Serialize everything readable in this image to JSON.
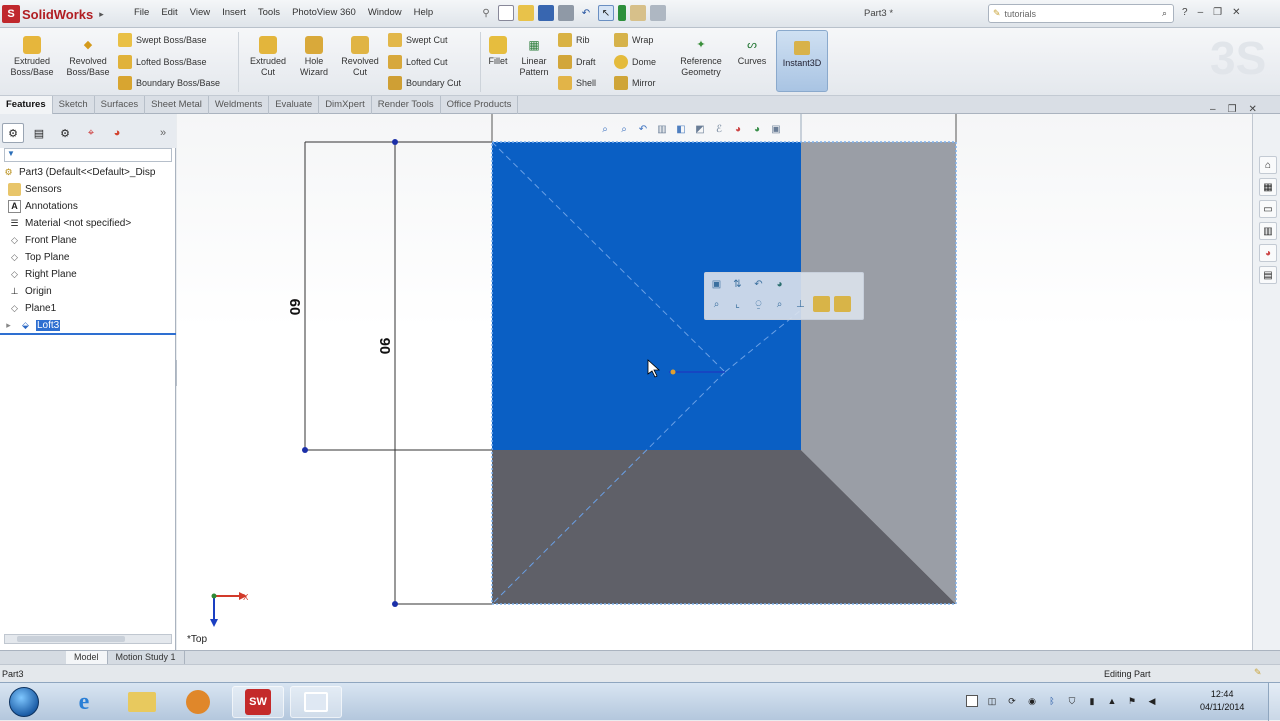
{
  "app": {
    "name": "SolidWorks",
    "document_title": "Part3 *",
    "menus": [
      "File",
      "Edit",
      "View",
      "Insert",
      "Tools",
      "PhotoView 360",
      "Window",
      "Help"
    ],
    "search_placeholder": "tutorials"
  },
  "commands": {
    "extruded_boss": "Extruded Boss/Base",
    "revolved_boss": "Revolved Boss/Base",
    "swept_boss": "Swept Boss/Base",
    "lofted_boss": "Lofted Boss/Base",
    "boundary_boss": "Boundary Boss/Base",
    "extruded_cut": "Extruded Cut",
    "hole_wizard": "Hole Wizard",
    "revolved_cut": "Revolved Cut",
    "swept_cut": "Swept Cut",
    "lofted_cut": "Lofted Cut",
    "boundary_cut": "Boundary Cut",
    "fillet": "Fillet",
    "linear_pattern": "Linear Pattern",
    "rib": "Rib",
    "draft": "Draft",
    "shell": "Shell",
    "wrap": "Wrap",
    "dome": "Dome",
    "mirror": "Mirror",
    "reference_geometry": "Reference Geometry",
    "curves": "Curves",
    "instant3d": "Instant3D"
  },
  "tabs": [
    "Features",
    "Sketch",
    "Surfaces",
    "Sheet Metal",
    "Weldments",
    "Evaluate",
    "DimXpert",
    "Render Tools",
    "Office Products"
  ],
  "feature_tree": {
    "filter_placeholder": "",
    "items": [
      {
        "label": "Part3  (Default<<Default>_Disp",
        "icon": "part-icon"
      },
      {
        "label": "Sensors",
        "icon": "sensors-icon"
      },
      {
        "label": "Annotations",
        "icon": "annotations-icon"
      },
      {
        "label": "Material <not specified>",
        "icon": "material-icon"
      },
      {
        "label": "Front Plane",
        "icon": "plane-icon"
      },
      {
        "label": "Top Plane",
        "icon": "plane-icon"
      },
      {
        "label": "Right Plane",
        "icon": "plane-icon"
      },
      {
        "label": "Origin",
        "icon": "origin-icon"
      },
      {
        "label": "Plane1",
        "icon": "plane-icon"
      },
      {
        "label": "Loft3",
        "icon": "loft-icon",
        "selected": true
      }
    ]
  },
  "graphics": {
    "view_name": "*Top",
    "dimension_left": "60",
    "dimension_right": "90",
    "axis_x": "X",
    "face_color": "#0a5fc4",
    "side_color": "#9a9ea6",
    "bottom_color": "#5f6068"
  },
  "bottom_tabs": [
    "Model",
    "Motion Study 1"
  ],
  "status": {
    "left": "Part3",
    "right": "Editing Part"
  },
  "taskbar": {
    "time": "12:44",
    "date": "04/11/2014",
    "sw_label": "SW"
  }
}
